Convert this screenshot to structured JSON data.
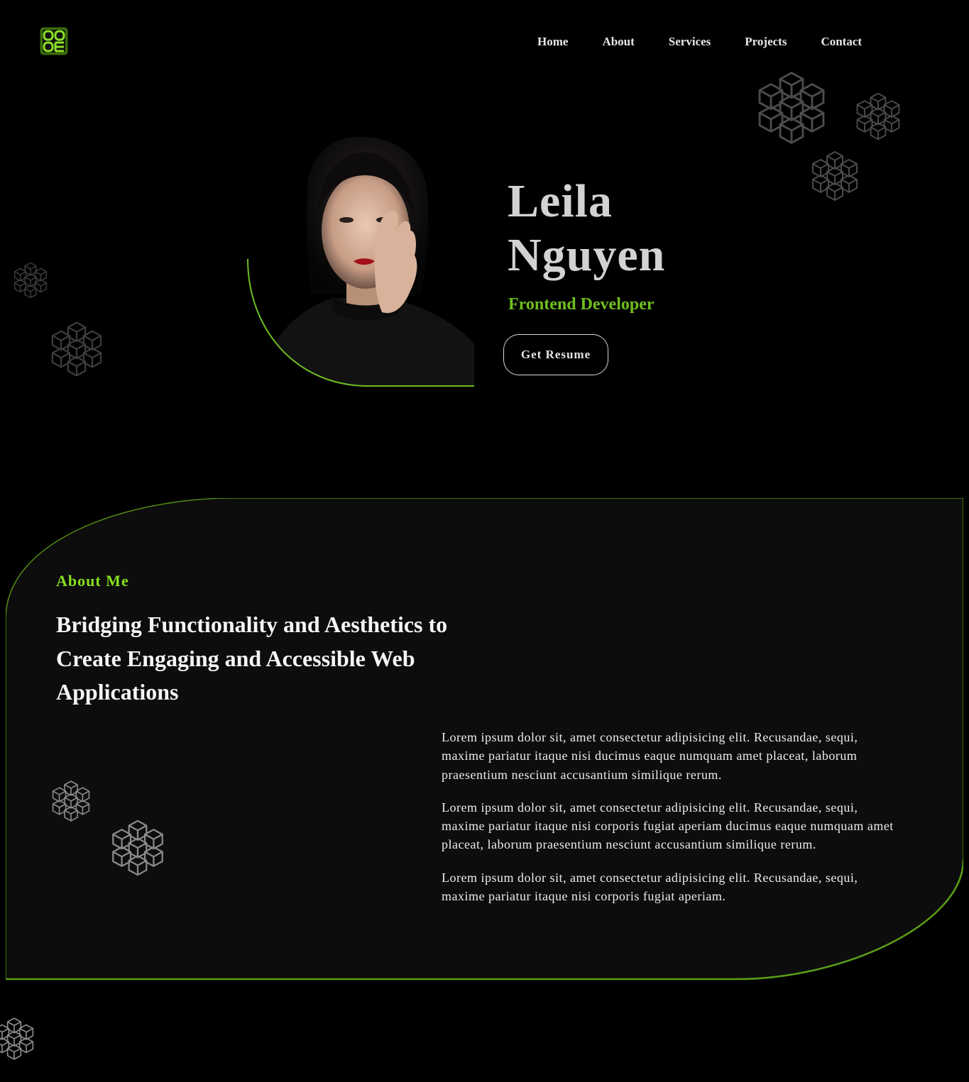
{
  "header": {
    "logo_icon": "grid-logo-icon",
    "nav": [
      {
        "label": "Home"
      },
      {
        "label": "About"
      },
      {
        "label": "Services"
      },
      {
        "label": "Projects"
      },
      {
        "label": "Contact"
      }
    ]
  },
  "hero": {
    "name_first": "Leila",
    "name_last": "Nguyen",
    "role": "Frontend Developer",
    "resume_button": "Get Resume"
  },
  "about": {
    "eyebrow": "About Me",
    "heading": "Bridging Functionality and Aesthetics to Create Engaging and Accessible Web Applications",
    "paragraphs": [
      "Lorem ipsum dolor sit, amet consectetur adipisicing elit. Recusandae, sequi, maxime pariatur itaque nisi ducimus eaque numquam amet placeat, laborum praesentium nesciunt accusantium similique rerum.",
      "Lorem ipsum dolor sit, amet consectetur adipisicing elit. Recusandae, sequi, maxime pariatur itaque nisi corporis fugiat aperiam ducimus eaque numquam amet placeat, laborum praesentium nesciunt accusantium similique rerum.",
      "Lorem ipsum dolor sit, amet consectetur adipisicing elit. Recusandae, sequi, maxime pariatur itaque nisi corporis fugiat aperiam."
    ]
  },
  "colors": {
    "accent": "#6fbf1f",
    "accent_bright": "#86e01e",
    "background": "#000000",
    "card": "#0d0d0d"
  }
}
